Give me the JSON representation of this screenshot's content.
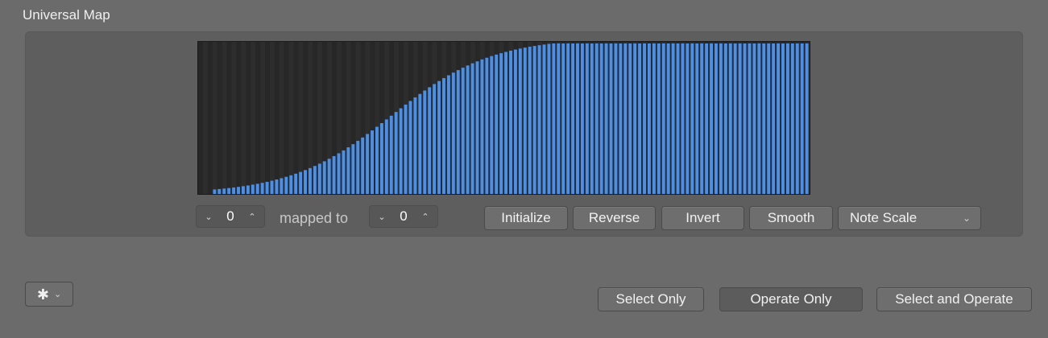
{
  "window": {
    "title": "Universal Map"
  },
  "map": {
    "bar_color": "#4a8fe8",
    "background_color": "#2a2a2a",
    "curve": "s-curve rising from 0 to maximum, plateau from about step 70 onward"
  },
  "input_stepper": {
    "value": "0",
    "down_icon": "chevron-down-icon",
    "up_icon": "chevron-up-icon"
  },
  "mapped_label": "mapped to",
  "output_stepper": {
    "value": "0",
    "down_icon": "chevron-down-icon",
    "up_icon": "chevron-up-icon"
  },
  "buttons": {
    "initialize": "Initialize",
    "reverse": "Reverse",
    "invert": "Invert",
    "smooth": "Smooth"
  },
  "scale_select": {
    "selected": "Note Scale",
    "icon": "chevron-down-icon"
  },
  "actions_menu": {
    "icon": "gear-icon",
    "menu_icon": "chevron-down-icon"
  },
  "footer": {
    "select_only": "Select Only",
    "operate_only": "Operate Only",
    "select_and_operate": "Select and Operate"
  }
}
